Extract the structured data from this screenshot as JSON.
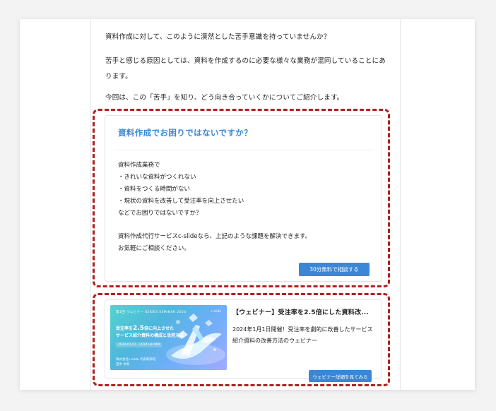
{
  "article": {
    "paragraphs": [
      "資料作成に対して、このように漠然とした苦手意識を持っていませんか？",
      "苦手と感じる原因としては、資料を作成するのに必要な様々な業務が混同していることにあります。",
      "今回は、この「苦手」を知り、どう向き合っていくかについてご紹介します。"
    ]
  },
  "callout": {
    "title": "資料作成でお困りではないですか？",
    "body_lines": [
      "資料作成業務で",
      "・きれいな資料がつくれない",
      "・資料をつくる時間がない",
      "・現状の資料を改善して受注率を向上させたい",
      "などでお困りではないですか？",
      "資料作成代行サービスc-slideなら、上記のような課題を解決できます。",
      "お気軽にご相談ください。"
    ],
    "button_label": "30分無料で相談する"
  },
  "webinar": {
    "thumbnail": {
      "header": "第1回 ウェビナー SERIES SEMINAR 2024",
      "logo_text": "c-slide",
      "line1_prefix": "受注率を",
      "line1_big": "2.5",
      "line1_suffix": "倍に向上させた",
      "line2": "サービス紹介資料の構成と活用方法",
      "dates": "2024.01.01 - 2024 HH:MM",
      "org": "株式会社c-slide 代表取締役\n田中 太郎"
    },
    "title": "【ウェビナー】受注率を2.5倍にした資料改...",
    "description": "2024年1月1日開催！受注率を劇的に改善したサービス紹介資料の改善方法のウェビナー",
    "button_label": "ウェビナー詳細を見てみる"
  }
}
